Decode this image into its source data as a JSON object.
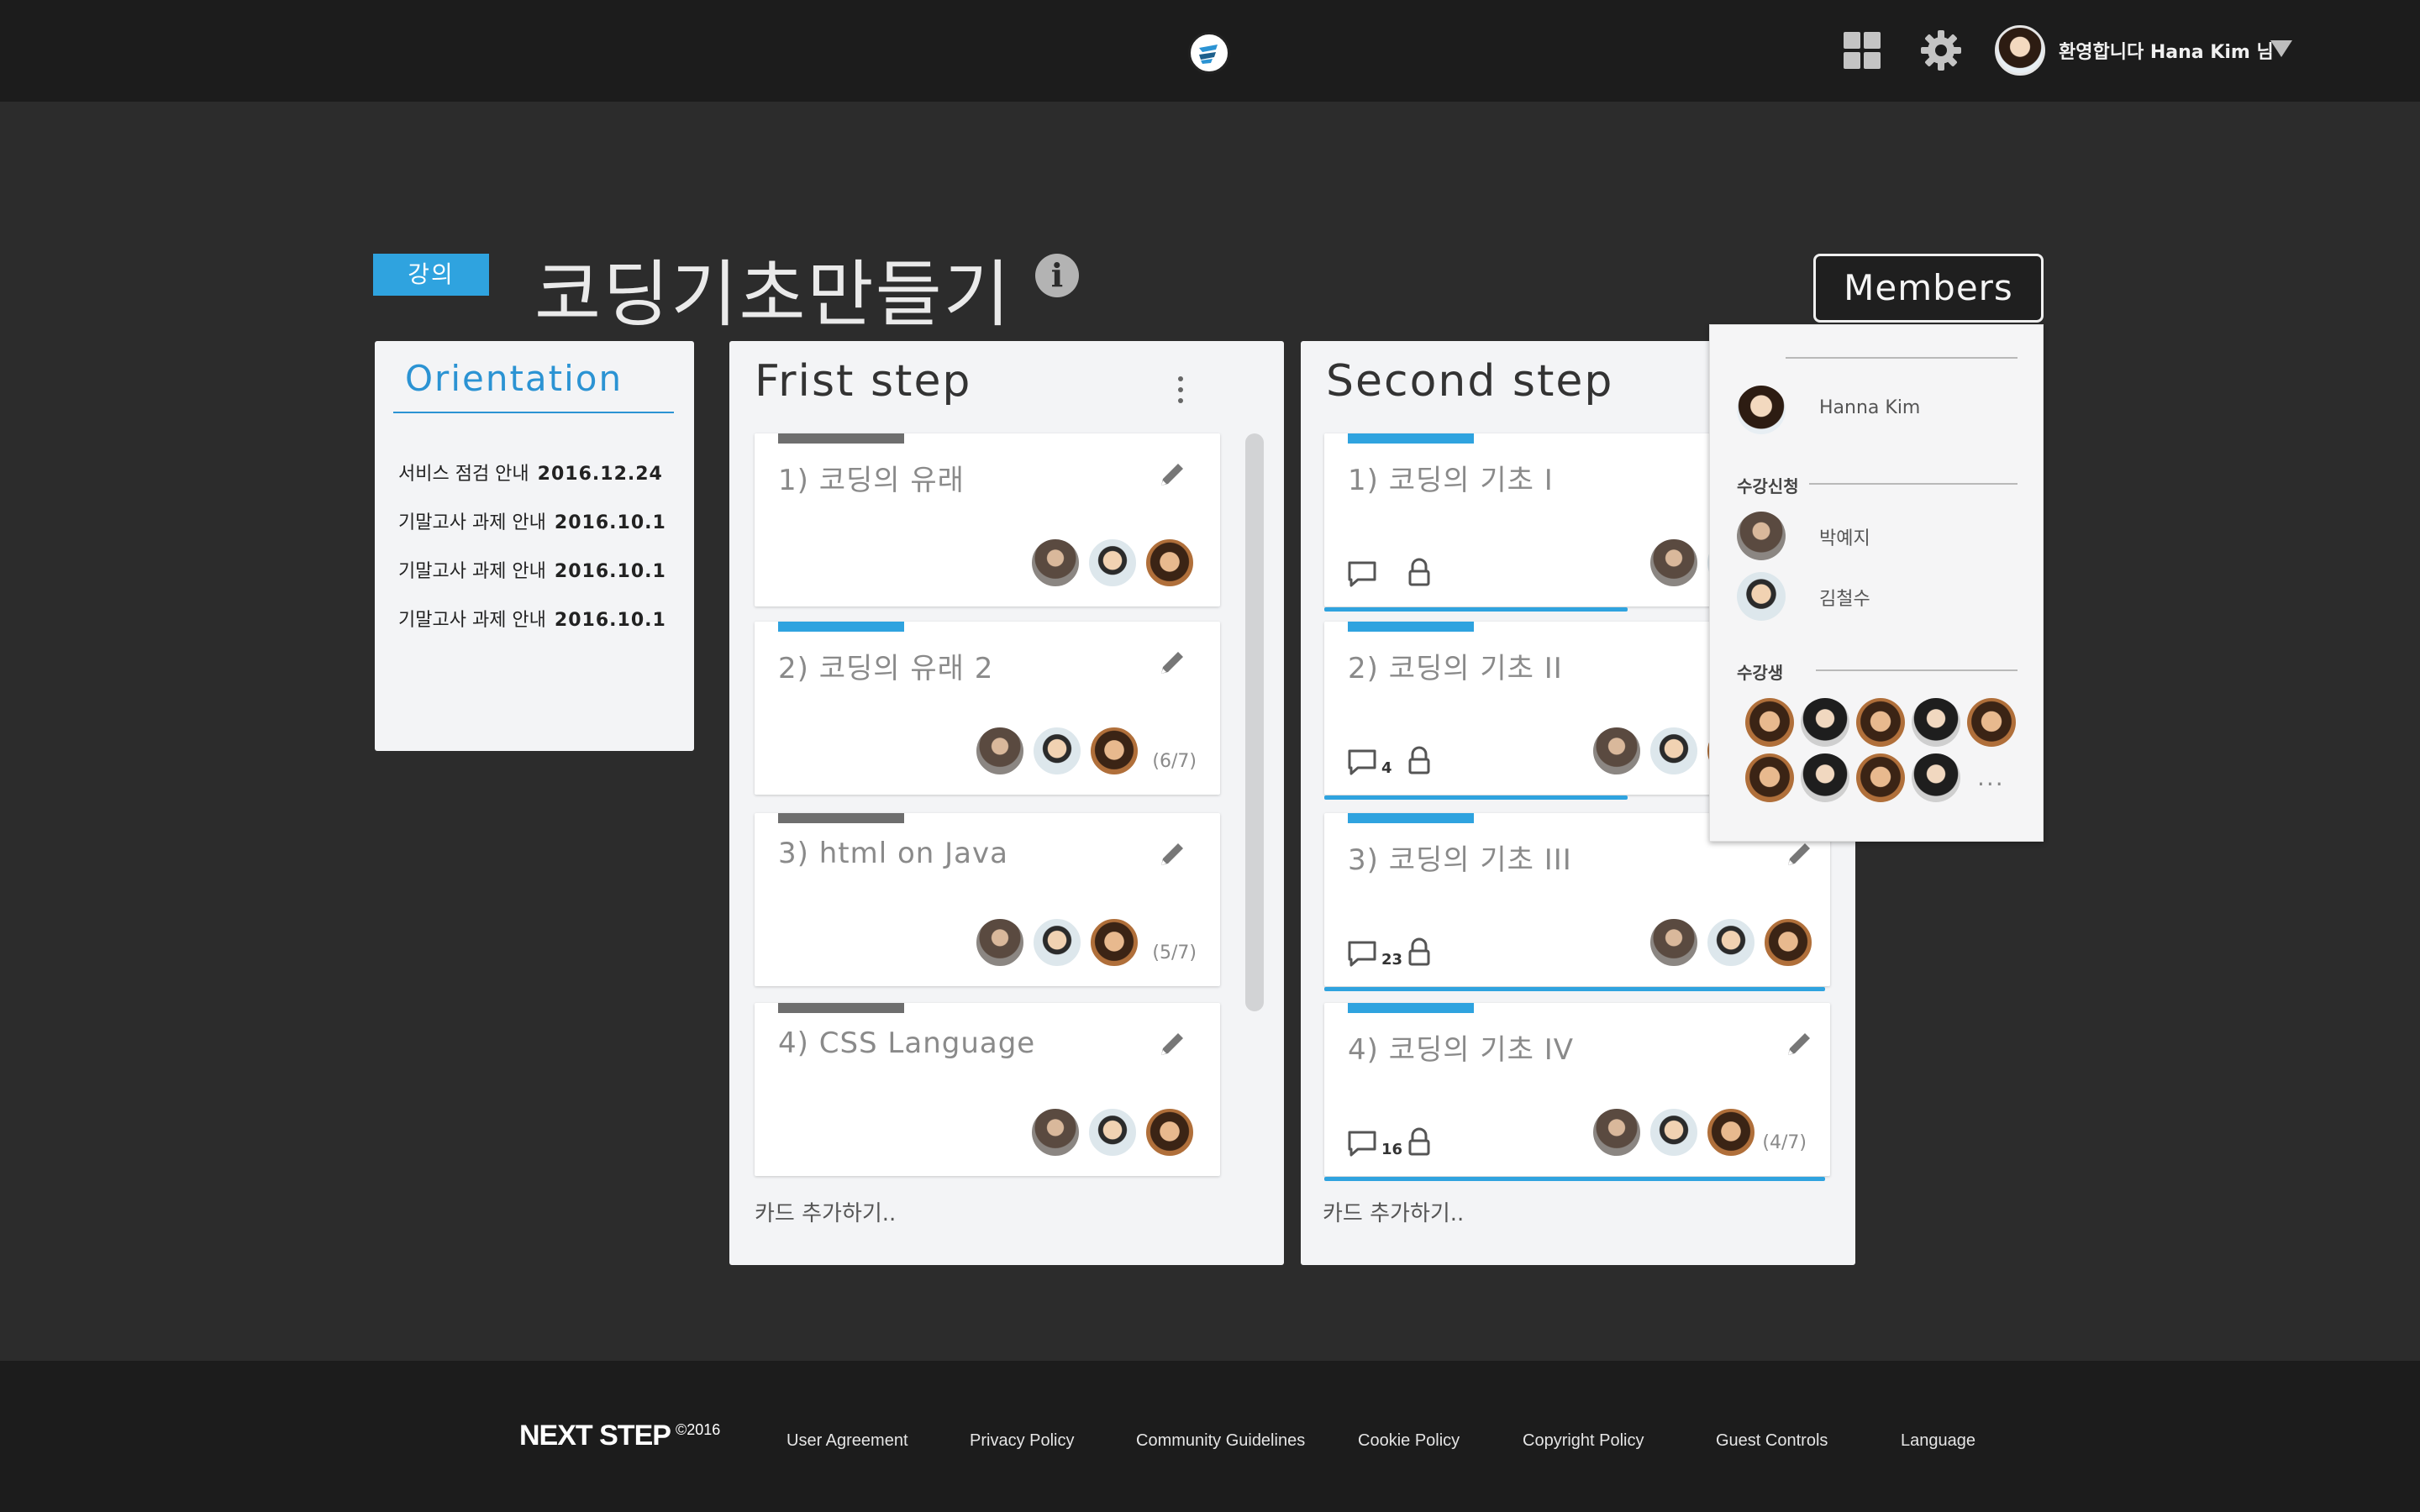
{
  "header": {
    "greeting": "환영합니다 Hana Kim 님",
    "icons": [
      "app-logo-icon",
      "apps-grid-icon",
      "gear-icon",
      "avatar",
      "caret-down-icon"
    ]
  },
  "board": {
    "badge": "강의",
    "title": "코딩기초만들기",
    "members_button": "Members"
  },
  "orientation": {
    "title": "Orientation",
    "items": [
      {
        "label": "서비스 점검 안내",
        "date": "2016.12.24"
      },
      {
        "label": "기말고사 과제 안내",
        "date": "2016.10.1"
      },
      {
        "label": "기말고사 과제 안내",
        "date": "2016.10.1"
      },
      {
        "label": "기말고사 과제 안내",
        "date": "2016.10.1"
      }
    ]
  },
  "columns": [
    {
      "title": "Frist step",
      "add_card": "카드 추가하기..",
      "cards": [
        {
          "title": "1) 코딩의 유래",
          "count": ""
        },
        {
          "title": "2) 코딩의 유래 2",
          "count": "(6/7)"
        },
        {
          "title": "3) html on Java",
          "count": "(5/7)"
        },
        {
          "title": "4) CSS Language",
          "count": ""
        }
      ]
    },
    {
      "title": "Second step",
      "add_card": "카드 추가하기..",
      "cards": [
        {
          "title": "1) 코딩의 기초 I",
          "comments": "",
          "progress": 0.6
        },
        {
          "title": "2) 코딩의 기초 II",
          "comments": "4",
          "progress": 0.6
        },
        {
          "title": "3) 코딩의 기초 III",
          "comments": "23",
          "progress": 0.99
        },
        {
          "title": "4) 코딩의 기초 IV",
          "comments": "16",
          "count": "(4/7)",
          "progress": 0.99
        }
      ]
    }
  ],
  "members": {
    "owner": "Hanna Kim",
    "applicants_label": "수강신청",
    "applicants": [
      "박예지",
      "김철수"
    ],
    "students_label": "수강생",
    "more": "···"
  },
  "footer": {
    "brand": "NEXT STEP",
    "copyright": "©2016",
    "links": [
      "User Agreement",
      "Privacy Policy",
      "Community Guidelines",
      "Cookie Policy",
      "Copyright Policy",
      "Guest Controls",
      "Language"
    ]
  },
  "colors": {
    "accent": "#2fa3df",
    "topbar": "#1c1c1c",
    "background": "#2c2c2c"
  }
}
